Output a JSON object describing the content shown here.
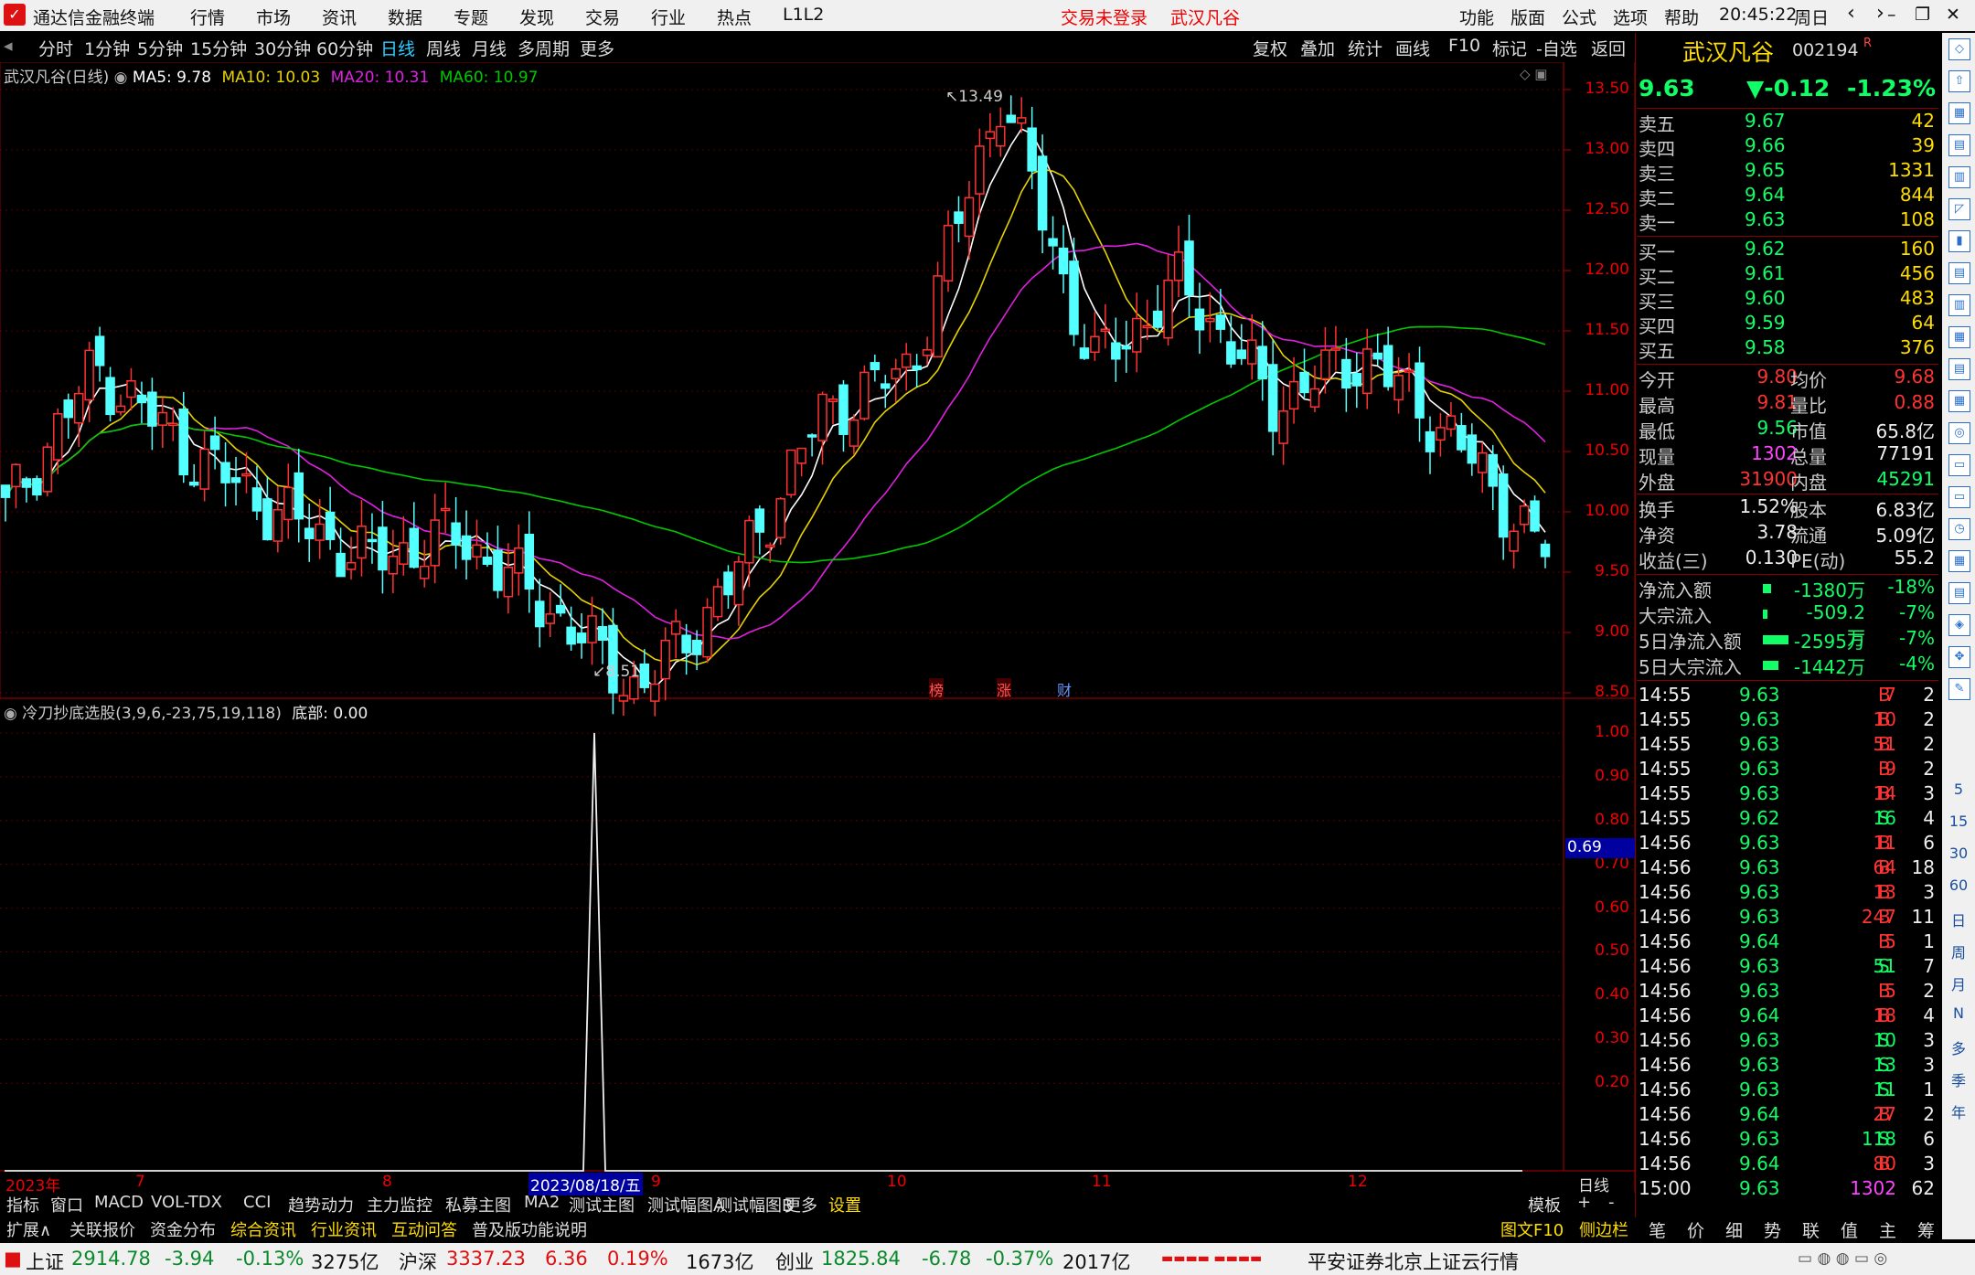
{
  "titlebar": {
    "app_name": "通达信金融终端",
    "menus": [
      "行情",
      "市场",
      "资讯",
      "数据",
      "专题",
      "发现",
      "交易",
      "行业",
      "热点",
      "L1L2"
    ],
    "trade_status": "交易未登录",
    "stock_name": "武汉凡谷",
    "right_menus": [
      "功能",
      "版面",
      "公式",
      "选项",
      "帮助"
    ],
    "time": "20:45:22",
    "weekday": "周日"
  },
  "periods": [
    "分时",
    "1分钟",
    "5分钟",
    "15分钟",
    "30分钟",
    "60分钟",
    "日线",
    "周线",
    "月线",
    "多周期",
    "更多"
  ],
  "active_period": "日线",
  "chart_tools": [
    "复权",
    "叠加",
    "统计",
    "画线",
    "F10",
    "标记",
    "-自选",
    "返回"
  ],
  "main_chart": {
    "label": "武汉凡谷(日线)",
    "ma5": "MA5: 9.78",
    "ma10": "MA10: 10.03",
    "ma20": "MA20: 10.31",
    "ma60": "MA60: 10.97",
    "high_label": "13.49",
    "low_label": "8.51",
    "yticks": [
      "13.50",
      "13.00",
      "12.50",
      "12.00",
      "11.50",
      "11.00",
      "10.50",
      "10.00",
      "9.50",
      "9.00",
      "8.50"
    ],
    "markers": [
      "榜",
      "涨",
      "财"
    ]
  },
  "indicator": {
    "label": "冷刀抄底选股(3,9,6,-23,75,19,118)",
    "value_label": "底部: 0.00",
    "yticks": [
      "1.00",
      "0.90",
      "0.80",
      "0.70",
      "0.60",
      "0.50",
      "0.40",
      "0.30",
      "0.20"
    ],
    "cursor_value": "0.69"
  },
  "x_axis": {
    "labels": [
      "2023年",
      "7",
      "8",
      "9",
      "10",
      "11",
      "12"
    ],
    "cursor_date": "2023/08/18/五",
    "period_label": "日线"
  },
  "chart_data": [
    {
      "type": "candlestick",
      "title": "武汉凡谷(日线)",
      "series": [
        {
          "name": "MA5",
          "color": "#ffffff"
        },
        {
          "name": "MA10",
          "color": "#e6d200"
        },
        {
          "name": "MA20",
          "color": "#e020e0"
        },
        {
          "name": "MA60",
          "color": "#00c800"
        }
      ],
      "ylim": [
        8.4,
        13.6
      ],
      "trend_points": [
        [
          "2023-06",
          10.0
        ],
        [
          "2023-06",
          11.2
        ],
        [
          "2023-07",
          10.5
        ],
        [
          "2023-07",
          10.0
        ],
        [
          "2023-07",
          9.6
        ],
        [
          "2023-08",
          9.8
        ],
        [
          "2023-08",
          9.2
        ],
        [
          "2023-08-18",
          8.51
        ],
        [
          "2023-09",
          9.4
        ],
        [
          "2023-09",
          10.8
        ],
        [
          "2023-10",
          11.2
        ],
        [
          "2023-10",
          13.49
        ],
        [
          "2023-10",
          11.2
        ],
        [
          "2023-11",
          11.9
        ],
        [
          "2023-11",
          10.9
        ],
        [
          "2023-12",
          11.3
        ],
        [
          "2023-12",
          10.6
        ],
        [
          "2023-12",
          9.63
        ]
      ]
    },
    {
      "type": "line",
      "title": "冷刀抄底选股(3,9,6,-23,75,19,118)",
      "ylim": [
        0.0,
        1.05
      ],
      "points": [
        [
          "2023-08-17",
          0
        ],
        [
          "2023-08-18",
          1.0
        ],
        [
          "2023-08-21",
          0
        ]
      ]
    }
  ],
  "quote": {
    "name": "武汉凡谷",
    "code": "002194",
    "price": "9.63",
    "change": "▼-0.12",
    "change_pct": "-1.23%",
    "asks": [
      {
        "label": "卖五",
        "price": "9.67",
        "vol": "42"
      },
      {
        "label": "卖四",
        "price": "9.66",
        "vol": "39"
      },
      {
        "label": "卖三",
        "price": "9.65",
        "vol": "1331"
      },
      {
        "label": "卖二",
        "price": "9.64",
        "vol": "844"
      },
      {
        "label": "卖一",
        "price": "9.63",
        "vol": "108"
      }
    ],
    "bids": [
      {
        "label": "买一",
        "price": "9.62",
        "vol": "160"
      },
      {
        "label": "买二",
        "price": "9.61",
        "vol": "456"
      },
      {
        "label": "买三",
        "price": "9.60",
        "vol": "483"
      },
      {
        "label": "买四",
        "price": "9.59",
        "vol": "64"
      },
      {
        "label": "买五",
        "price": "9.58",
        "vol": "376"
      }
    ],
    "stats": [
      {
        "l1": "今开",
        "v1": "9.80",
        "l2": "均价",
        "v2": "9.68"
      },
      {
        "l1": "最高",
        "v1": "9.81",
        "l2": "量比",
        "v2": "0.88"
      },
      {
        "l1": "最低",
        "v1": "9.56",
        "l2": "市值",
        "v2": "65.8亿"
      },
      {
        "l1": "现量",
        "v1": "1302",
        "l2": "总量",
        "v2": "77191"
      },
      {
        "l1": "外盘",
        "v1": "31900",
        "l2": "内盘",
        "v2": "45291"
      }
    ],
    "stats2": [
      {
        "l1": "换手",
        "v1": "1.52%",
        "l2": "股本",
        "v2": "6.83亿"
      },
      {
        "l1": "净资",
        "v1": "3.78",
        "l2": "流通",
        "v2": "5.09亿"
      },
      {
        "l1": "收益(三)",
        "v1": "0.130",
        "l2": "PE(动)",
        "v2": "55.2"
      }
    ],
    "flows": [
      {
        "label": "净流入额",
        "value": "-1380万",
        "pct": "-18%",
        "bar": 0.18
      },
      {
        "label": "大宗流入",
        "value": "-509.2万",
        "pct": "-7%",
        "bar": 0.05
      },
      {
        "label": "5日净流入额",
        "value": "-2595万",
        "pct": "-7%",
        "bar": 0.7
      },
      {
        "label": "5日大宗流入",
        "value": "-1442万",
        "pct": "-4%",
        "bar": 0.4
      }
    ],
    "ticks": [
      {
        "t": "14:55",
        "p": "9.63",
        "v": "7",
        "s": "B",
        "n": "2"
      },
      {
        "t": "14:55",
        "p": "9.63",
        "v": "10",
        "s": "B",
        "n": "2"
      },
      {
        "t": "14:55",
        "p": "9.63",
        "v": "51",
        "s": "B",
        "n": "2"
      },
      {
        "t": "14:55",
        "p": "9.63",
        "v": "9",
        "s": "B",
        "n": "2"
      },
      {
        "t": "14:55",
        "p": "9.63",
        "v": "14",
        "s": "B",
        "n": "3"
      },
      {
        "t": "14:55",
        "p": "9.62",
        "v": "16",
        "s": "S",
        "n": "4"
      },
      {
        "t": "14:56",
        "p": "9.63",
        "v": "11",
        "s": "B",
        "n": "6"
      },
      {
        "t": "14:56",
        "p": "9.63",
        "v": "64",
        "s": "B",
        "n": "18"
      },
      {
        "t": "14:56",
        "p": "9.63",
        "v": "13",
        "s": "B",
        "n": "3"
      },
      {
        "t": "14:56",
        "p": "9.63",
        "v": "247",
        "s": "B",
        "n": "11"
      },
      {
        "t": "14:56",
        "p": "9.64",
        "v": "5",
        "s": "B",
        "n": "1"
      },
      {
        "t": "14:56",
        "p": "9.63",
        "v": "51",
        "s": "S",
        "n": "7"
      },
      {
        "t": "14:56",
        "p": "9.63",
        "v": "5",
        "s": "B",
        "n": "2"
      },
      {
        "t": "14:56",
        "p": "9.64",
        "v": "18",
        "s": "B",
        "n": "4"
      },
      {
        "t": "14:56",
        "p": "9.63",
        "v": "10",
        "s": "S",
        "n": "3"
      },
      {
        "t": "14:56",
        "p": "9.63",
        "v": "13",
        "s": "S",
        "n": "3"
      },
      {
        "t": "14:56",
        "p": "9.63",
        "v": "11",
        "s": "S",
        "n": "1"
      },
      {
        "t": "14:56",
        "p": "9.64",
        "v": "27",
        "s": "B",
        "n": "2"
      },
      {
        "t": "14:56",
        "p": "9.63",
        "v": "118",
        "s": "S",
        "n": "6"
      },
      {
        "t": "14:56",
        "p": "9.64",
        "v": "80",
        "s": "B",
        "n": "3"
      },
      {
        "t": "15:00",
        "p": "9.63",
        "v": "1302",
        "s": "",
        "n": "62"
      }
    ]
  },
  "bottom_tabs1": [
    "指标",
    "窗口",
    "MACD",
    "VOL-TDX",
    "CCI",
    "趋势动力",
    "主力监控",
    "私募主图",
    "MA2",
    "测试主图",
    "测试幅图A",
    "测试幅图B",
    "更多",
    "设置"
  ],
  "bottom_tabs1_right": [
    "模板",
    "+",
    "-"
  ],
  "bottom_tabs2": [
    "扩展∧",
    "关联报价",
    "资金分布",
    "综合资讯",
    "行业资讯",
    "互动问答",
    "普及版功能说明"
  ],
  "bottom_tabs2_right": [
    "图文F10",
    "侧边栏《"
  ],
  "quote_tabs": [
    "笔",
    "价",
    "细",
    "势",
    "联",
    "值",
    "主",
    "筹"
  ],
  "statusbar": {
    "idx1_name": "上证",
    "idx1_val": "2914.78",
    "idx1_chg": "-3.94",
    "idx1_pct": "-0.13%",
    "idx1_amt": "3275亿",
    "idx2_name": "沪深",
    "idx2_val": "3337.23",
    "idx2_chg": "6.36",
    "idx2_pct": "0.19%",
    "idx2_amt": "1673亿",
    "idx3_name": "创业",
    "idx3_val": "1825.84",
    "idx3_chg": "-6.78",
    "idx3_pct": "-0.37%",
    "idx3_amt": "2017亿",
    "server": "平安证券北京上证云行情"
  },
  "side_icons": [
    "5",
    "15",
    "30",
    "60",
    "日",
    "周",
    "月",
    "N",
    "多",
    "季",
    "年"
  ]
}
